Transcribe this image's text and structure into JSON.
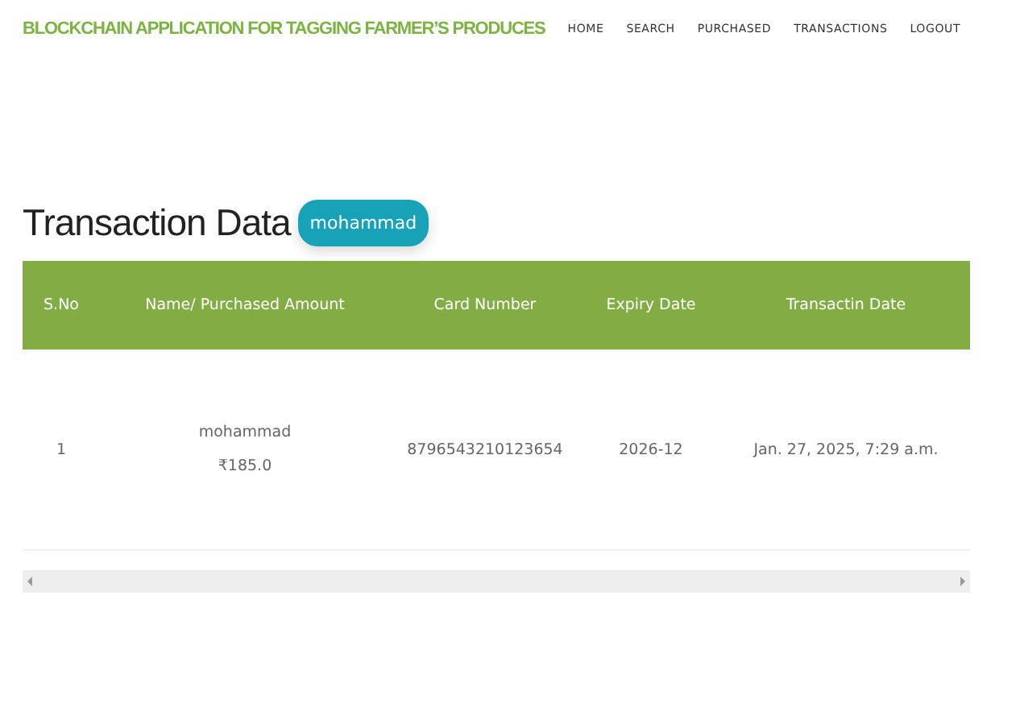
{
  "header": {
    "brand": "BLOCKCHAIN APPLICATION FOR TAGGING FARMER’S PRODUCES",
    "nav": [
      {
        "label": "HOME"
      },
      {
        "label": "SEARCH"
      },
      {
        "label": "PURCHASED"
      },
      {
        "label": "TRANSACTIONS"
      },
      {
        "label": "LOGOUT"
      }
    ]
  },
  "page": {
    "title": "Transaction Data",
    "user_badge": "mohammad"
  },
  "table": {
    "columns": [
      "S.No",
      "Name/ Purchased Amount",
      "Card Number",
      "Expiry Date",
      "Transactin Date"
    ],
    "rows": [
      {
        "sno": "1",
        "name": "mohammad",
        "amount": "₹185.0",
        "card_number": "8796543210123654",
        "expiry_date": "2026-12",
        "transaction_date": "Jan. 27, 2025, 7:29 a.m."
      }
    ]
  }
}
